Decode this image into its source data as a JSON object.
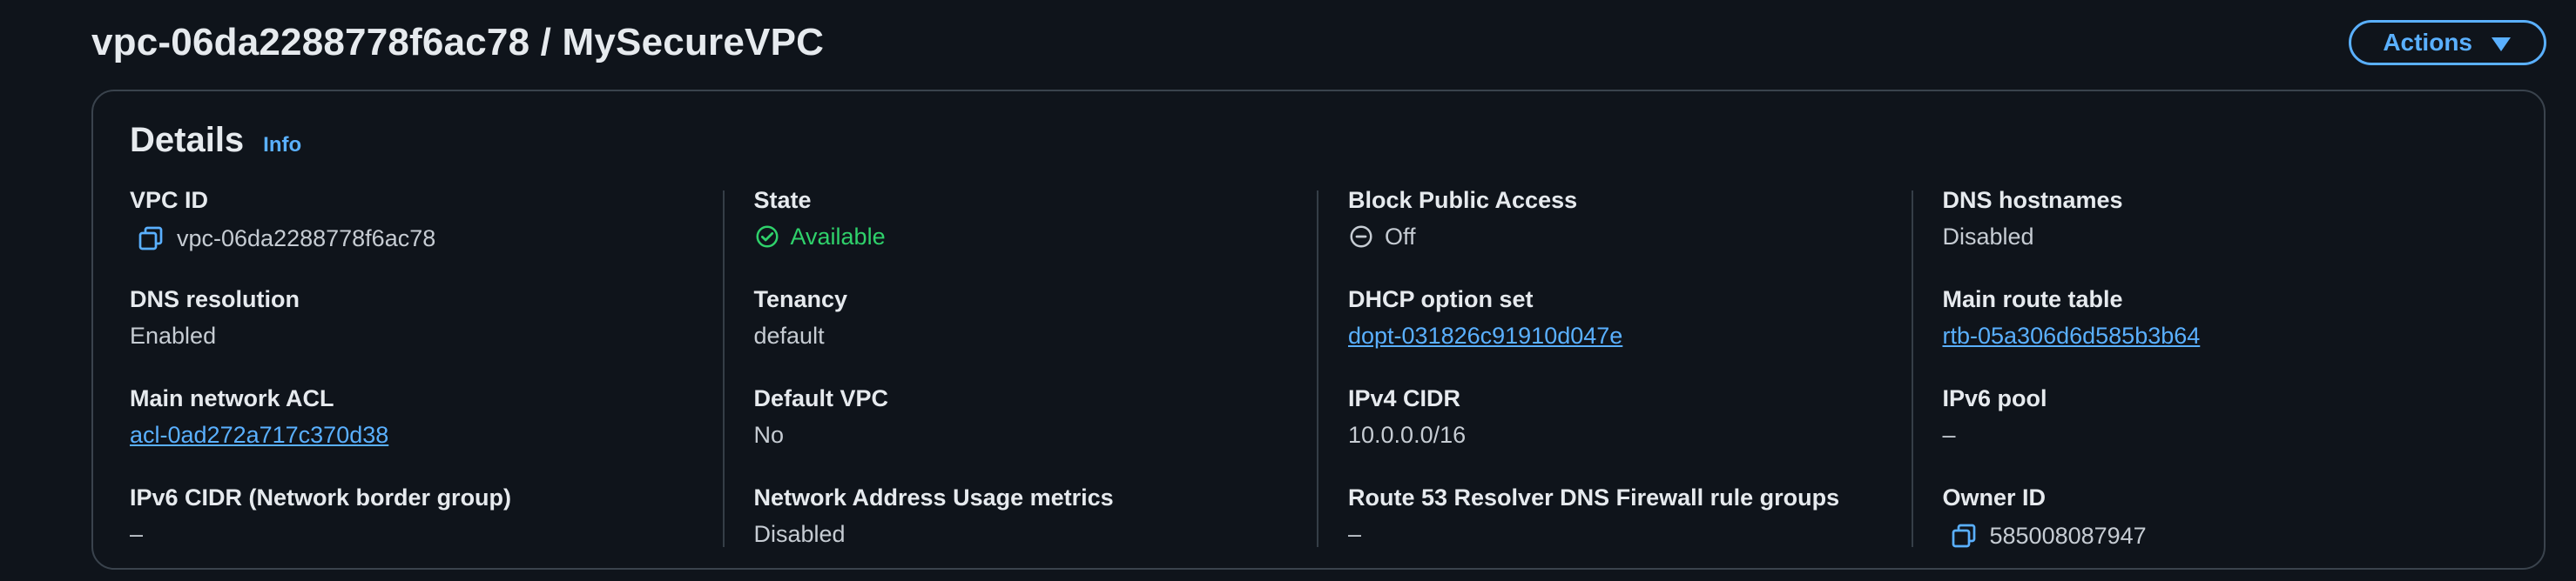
{
  "header": {
    "title": "vpc-06da2288778f6ac78 / MySecureVPC",
    "actions_label": "Actions"
  },
  "details": {
    "title": "Details",
    "info_label": "Info",
    "columns": [
      [
        {
          "label": "VPC ID",
          "value": "vpc-06da2288778f6ac78"
        },
        {
          "label": "DNS resolution",
          "value": "Enabled"
        },
        {
          "label": "Main network ACL",
          "value": "acl-0ad272a717c370d38"
        },
        {
          "label": "IPv6 CIDR (Network border group)",
          "value": "–"
        }
      ],
      [
        {
          "label": "State",
          "value": "Available"
        },
        {
          "label": "Tenancy",
          "value": "default"
        },
        {
          "label": "Default VPC",
          "value": "No"
        },
        {
          "label": "Network Address Usage metrics",
          "value": "Disabled"
        }
      ],
      [
        {
          "label": "Block Public Access",
          "value": "Off"
        },
        {
          "label": "DHCP option set",
          "value": "dopt-031826c91910d047e"
        },
        {
          "label": "IPv4 CIDR",
          "value": "10.0.0.0/16"
        },
        {
          "label": "Route 53 Resolver DNS Firewall rule groups",
          "value": "–"
        }
      ],
      [
        {
          "label": "DNS hostnames",
          "value": "Disabled"
        },
        {
          "label": "Main route table",
          "value": "rtb-05a306d6d585b3b64"
        },
        {
          "label": "IPv6 pool",
          "value": "–"
        },
        {
          "label": "Owner ID",
          "value": "585008087947"
        }
      ]
    ]
  },
  "icons": {
    "copy": "copy-icon",
    "status_available": "check-circle-icon",
    "status_off": "minus-circle-icon",
    "dropdown": "caret-down-icon"
  },
  "colors": {
    "accent_link": "#5ab0ff",
    "success": "#2fd16b",
    "border": "#3a434d",
    "background": "#0f141b"
  }
}
